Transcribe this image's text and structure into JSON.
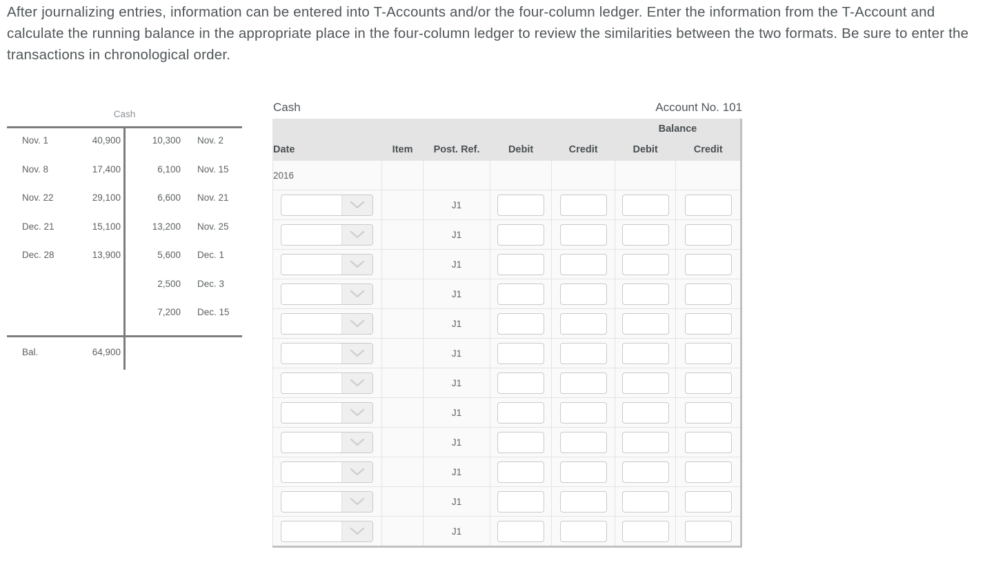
{
  "instructions": {
    "text": "After journalizing entries, information can be entered into T-Accounts and/or the four-column ledger. Enter the information from the T-Account and calculate the running balance in the appropriate place in the four-column ledger to review the similarities between the two formats. Be sure to enter the transactions in chronological order."
  },
  "t_account": {
    "title": "Cash",
    "debit_entries": [
      {
        "date": "Nov. 1",
        "amount": "40,900"
      },
      {
        "date": "Nov. 8",
        "amount": "17,400"
      },
      {
        "date": "Nov. 22",
        "amount": "29,100"
      },
      {
        "date": "Dec. 21",
        "amount": "15,100"
      },
      {
        "date": "Dec. 28",
        "amount": "13,900"
      }
    ],
    "credit_entries": [
      {
        "amount": "10,300",
        "date": "Nov. 2"
      },
      {
        "amount": "6,100",
        "date": "Nov. 15"
      },
      {
        "amount": "6,600",
        "date": "Nov. 21"
      },
      {
        "amount": "13,200",
        "date": "Nov. 25"
      },
      {
        "amount": "5,600",
        "date": "Dec. 1"
      },
      {
        "amount": "2,500",
        "date": "Dec. 3"
      },
      {
        "amount": "7,200",
        "date": "Dec. 15"
      }
    ],
    "balance": {
      "label": "Bal.",
      "amount": "64,900"
    }
  },
  "ledger": {
    "account_name": "Cash",
    "account_number": "Account No. 101",
    "group_header": "Balance",
    "columns": {
      "date": "Date",
      "item": "Item",
      "post_ref": "Post. Ref.",
      "debit": "Debit",
      "credit": "Credit",
      "balance_debit": "Debit",
      "balance_credit": "Credit"
    },
    "year_row": {
      "year": "2016"
    },
    "rows": [
      {
        "date": "",
        "item": "",
        "post_ref": "J1",
        "debit": "",
        "credit": "",
        "balance_debit": "",
        "balance_credit": ""
      },
      {
        "date": "",
        "item": "",
        "post_ref": "J1",
        "debit": "",
        "credit": "",
        "balance_debit": "",
        "balance_credit": ""
      },
      {
        "date": "",
        "item": "",
        "post_ref": "J1",
        "debit": "",
        "credit": "",
        "balance_debit": "",
        "balance_credit": ""
      },
      {
        "date": "",
        "item": "",
        "post_ref": "J1",
        "debit": "",
        "credit": "",
        "balance_debit": "",
        "balance_credit": ""
      },
      {
        "date": "",
        "item": "",
        "post_ref": "J1",
        "debit": "",
        "credit": "",
        "balance_debit": "",
        "balance_credit": ""
      },
      {
        "date": "",
        "item": "",
        "post_ref": "J1",
        "debit": "",
        "credit": "",
        "balance_debit": "",
        "balance_credit": ""
      },
      {
        "date": "",
        "item": "",
        "post_ref": "J1",
        "debit": "",
        "credit": "",
        "balance_debit": "",
        "balance_credit": ""
      },
      {
        "date": "",
        "item": "",
        "post_ref": "J1",
        "debit": "",
        "credit": "",
        "balance_debit": "",
        "balance_credit": ""
      },
      {
        "date": "",
        "item": "",
        "post_ref": "J1",
        "debit": "",
        "credit": "",
        "balance_debit": "",
        "balance_credit": ""
      },
      {
        "date": "",
        "item": "",
        "post_ref": "J1",
        "debit": "",
        "credit": "",
        "balance_debit": "",
        "balance_credit": ""
      },
      {
        "date": "",
        "item": "",
        "post_ref": "J1",
        "debit": "",
        "credit": "",
        "balance_debit": "",
        "balance_credit": ""
      },
      {
        "date": "",
        "item": "",
        "post_ref": "J1",
        "debit": "",
        "credit": "",
        "balance_debit": "",
        "balance_credit": ""
      }
    ]
  },
  "icons": {
    "date_dropdown": "chevron-down-icon"
  },
  "colors": {
    "text": "#4f5558",
    "muted_text": "#8b9296",
    "header_bg": "#e4e4e4",
    "row_bg": "#fafafa",
    "rule": "#7c7c7c",
    "input_border": "#c9c9c9"
  }
}
